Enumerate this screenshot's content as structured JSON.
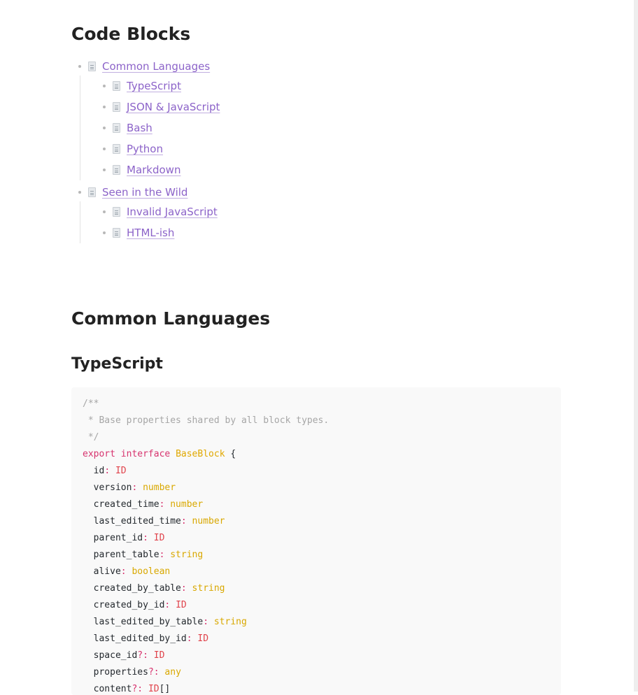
{
  "headings": {
    "code_blocks": "Code Blocks",
    "common_languages": "Common Languages",
    "typescript": "TypeScript"
  },
  "toc": [
    {
      "label": "Common Languages",
      "children": [
        "TypeScript",
        "JSON & JavaScript",
        "Bash",
        "Python",
        "Markdown"
      ]
    },
    {
      "label": "Seen in the Wild",
      "children": [
        "Invalid JavaScript",
        "HTML-ish"
      ]
    }
  ],
  "code": {
    "comment": [
      "/**",
      " * Base properties shared by all block types.",
      " */"
    ],
    "decl": {
      "kw1": "export",
      "kw2": "interface",
      "name": "BaseBlock",
      "brace": "{"
    },
    "fields": [
      {
        "key": "id",
        "sep": ": ",
        "type": "ID",
        "kind": "id"
      },
      {
        "key": "version",
        "sep": ": ",
        "type": "number",
        "kind": "type"
      },
      {
        "key": "created_time",
        "sep": ": ",
        "type": "number",
        "kind": "type"
      },
      {
        "key": "last_edited_time",
        "sep": ": ",
        "type": "number",
        "kind": "type"
      },
      {
        "key": "parent_id",
        "sep": ": ",
        "type": "ID",
        "kind": "id"
      },
      {
        "key": "parent_table",
        "sep": ": ",
        "type": "string",
        "kind": "type"
      },
      {
        "key": "alive",
        "sep": ": ",
        "type": "boolean",
        "kind": "type"
      },
      {
        "key": "created_by_table",
        "sep": ": ",
        "type": "string",
        "kind": "type"
      },
      {
        "key": "created_by_id",
        "sep": ": ",
        "type": "ID",
        "kind": "id"
      },
      {
        "key": "last_edited_by_table",
        "sep": ": ",
        "type": "string",
        "kind": "type"
      },
      {
        "key": "last_edited_by_id",
        "sep": ": ",
        "type": "ID",
        "kind": "id"
      },
      {
        "key": "space_id",
        "sep": "?: ",
        "type": "ID",
        "kind": "id"
      },
      {
        "key": "properties",
        "sep": "?: ",
        "type": "any",
        "kind": "type"
      },
      {
        "key": "content",
        "sep": "?: ",
        "type": "ID[]",
        "kind": "id"
      }
    ]
  },
  "colors": {
    "link": "#8c63c9",
    "keyword": "#d7336e",
    "type": "#d9a800",
    "id_type": "#e0434b",
    "comment": "#a6a6a6"
  },
  "icons": {
    "toc_item": "document-icon",
    "bullet": "bullet-dot-icon"
  }
}
